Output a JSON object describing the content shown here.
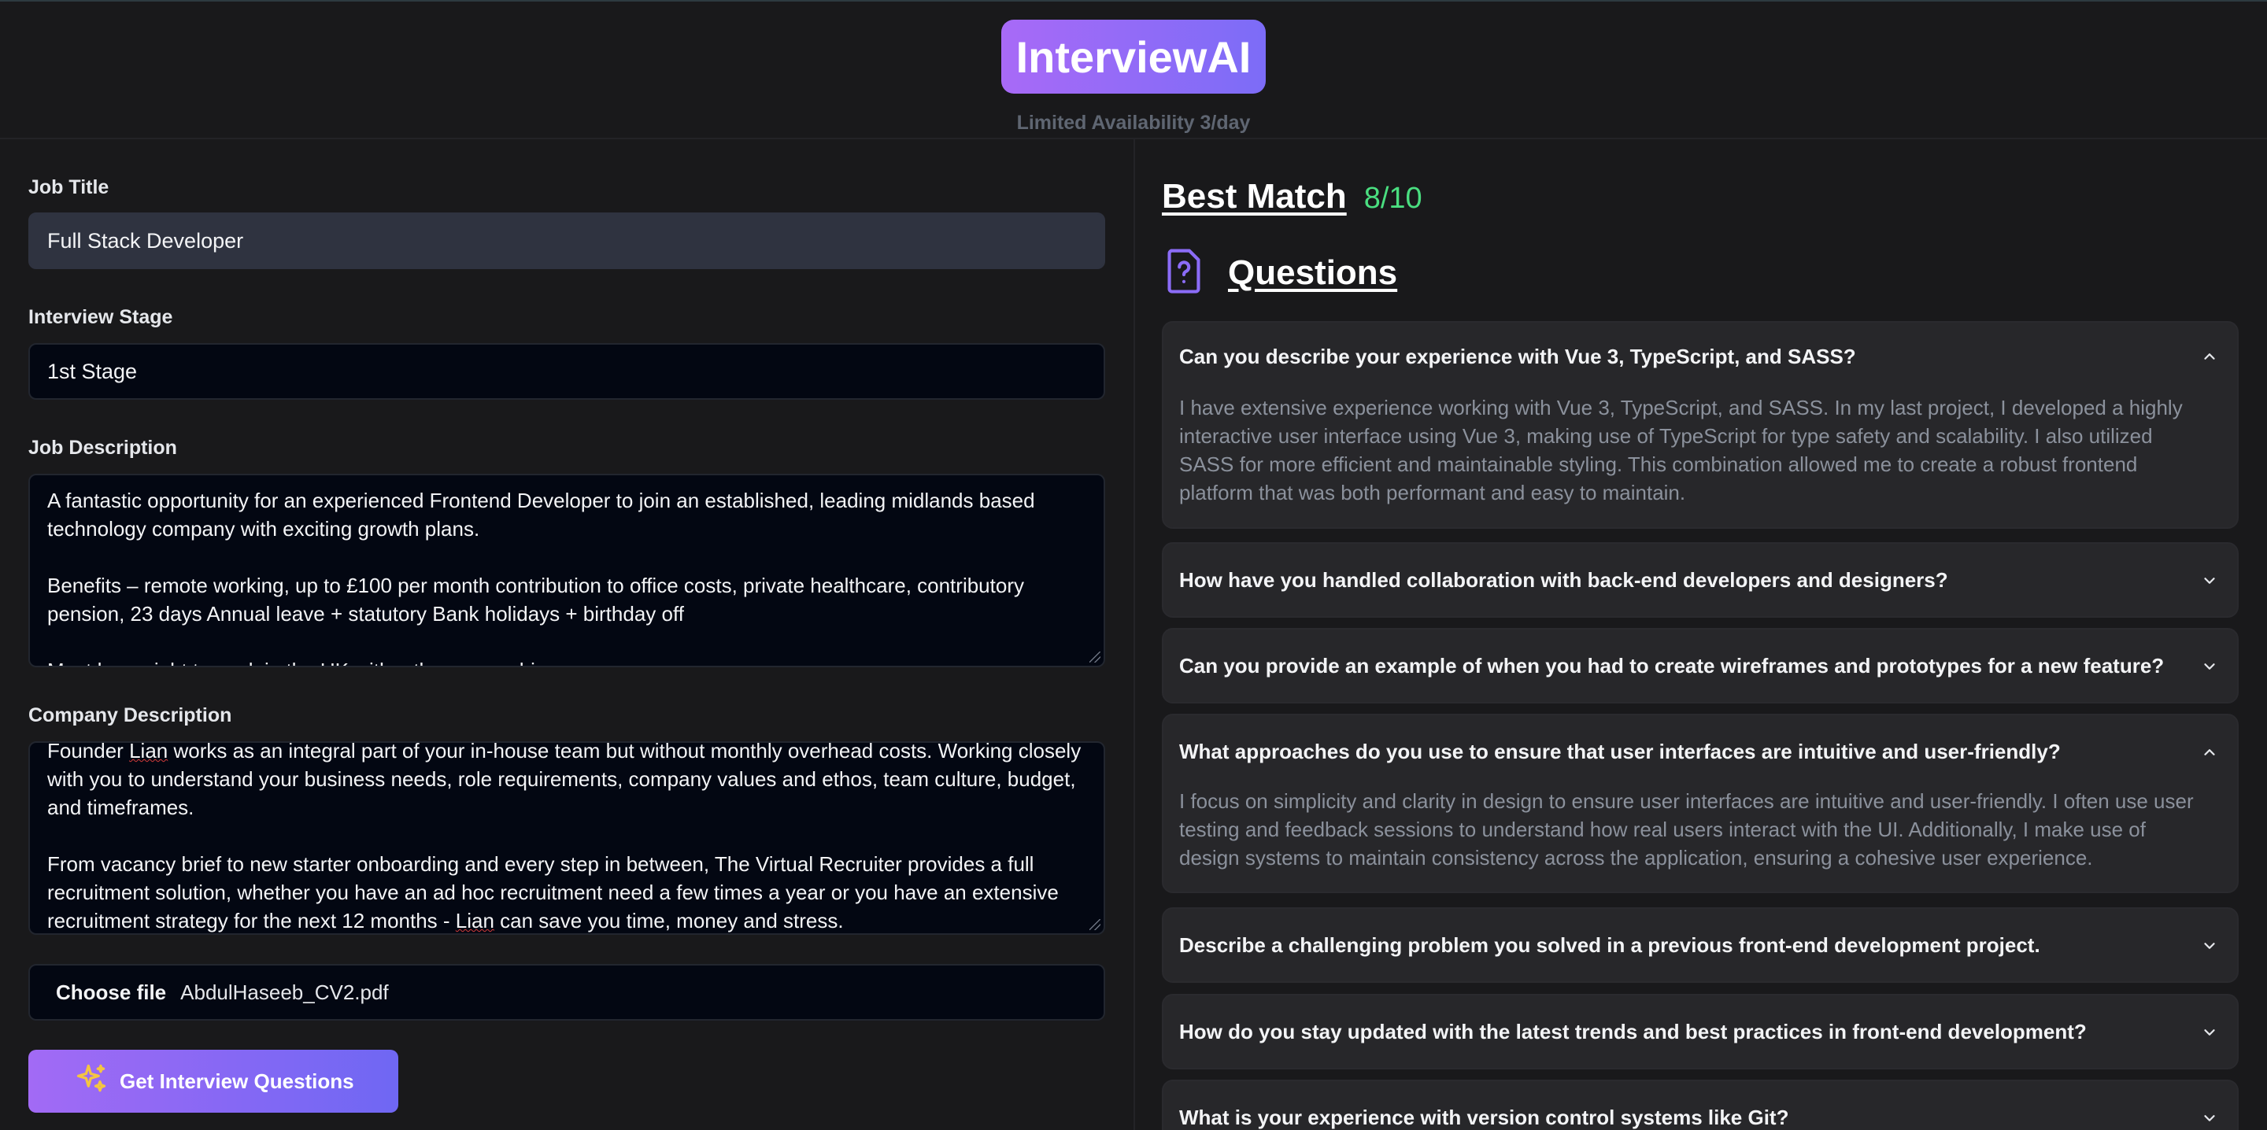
{
  "header": {
    "logo": "InterviewAI",
    "availability": "Limited Availability 3/day"
  },
  "form": {
    "job_title_label": "Job Title",
    "job_title_value": "Full Stack Developer",
    "stage_label": "Interview Stage",
    "stage_value": "1st Stage",
    "job_description_label": "Job Description",
    "job_description_p1": "A fantastic opportunity for an experienced Frontend Developer to join an established, leading midlands based technology company with exciting growth plans.",
    "job_description_p2": "Benefits – remote working, up to £100 per month contribution to office costs, private healthcare, contributory pension, 23 days Annual leave + statutory Bank holidays + birthday off",
    "job_description_p3": "Must have right to work in the UK withouth sponsorship",
    "company_description_label": "Company Description",
    "company_description_p1a": "Founder ",
    "company_description_p1_name": "Lian",
    "company_description_p1b": " works as an integral part of your in-house team but without monthly overhead costs. Working closely with you to understand your business needs, role requirements, company values and ethos, team culture, budget, and timeframes.",
    "company_description_p2a": "From vacancy brief to new starter onboarding and every step in between, The Virtual Recruiter provides a full recruitment solution, whether you have an ad hoc recruitment need a few times a year or you have an extensive recruitment strategy for the next 12 months - ",
    "company_description_p2_name": "Lian",
    "company_description_p2b": " can save you time, money and stress.",
    "file_button": "Choose file",
    "file_name": "AbdulHaseeb_CV2.pdf",
    "submit_label": "Get Interview Questions",
    "submit_icon": "sparkles-icon"
  },
  "results": {
    "best_match_label": "Best Match",
    "best_match_score": "8/10",
    "questions_label": "Questions",
    "questions_icon": "file-question-icon",
    "items": [
      {
        "question": "Can you describe your experience with Vue 3, TypeScript, and SASS?",
        "answer": "I have extensive experience working with Vue 3, TypeScript, and SASS. In my last project, I developed a highly interactive user interface using Vue 3, making use of TypeScript for type safety and scalability. I also utilized SASS for more efficient and maintainable styling. This combination allowed me to create a robust frontend platform that was both performant and easy to maintain.",
        "expanded": true
      },
      {
        "question": "How have you handled collaboration with back-end developers and designers?",
        "expanded": false
      },
      {
        "question": "Can you provide an example of when you had to create wireframes and prototypes for a new feature?",
        "expanded": false
      },
      {
        "question": "What approaches do you use to ensure that user interfaces are intuitive and user-friendly?",
        "answer": "I focus on simplicity and clarity in design to ensure user interfaces are intuitive and user-friendly. I often use user testing and feedback sessions to understand how real users interact with the UI. Additionally, I make use of design systems to maintain consistency across the application, ensuring a cohesive user experience.",
        "expanded": true
      },
      {
        "question": "Describe a challenging problem you solved in a previous front-end development project.",
        "expanded": false
      },
      {
        "question": "How do you stay updated with the latest trends and best practices in front-end development?",
        "expanded": false
      },
      {
        "question": "What is your experience with version control systems like Git?",
        "expanded": false
      }
    ]
  },
  "colors": {
    "accent_start": "#a86af7",
    "accent_end": "#6f67f3",
    "score_green": "#4ade80",
    "background": "#19191b",
    "card": "#27272a"
  }
}
